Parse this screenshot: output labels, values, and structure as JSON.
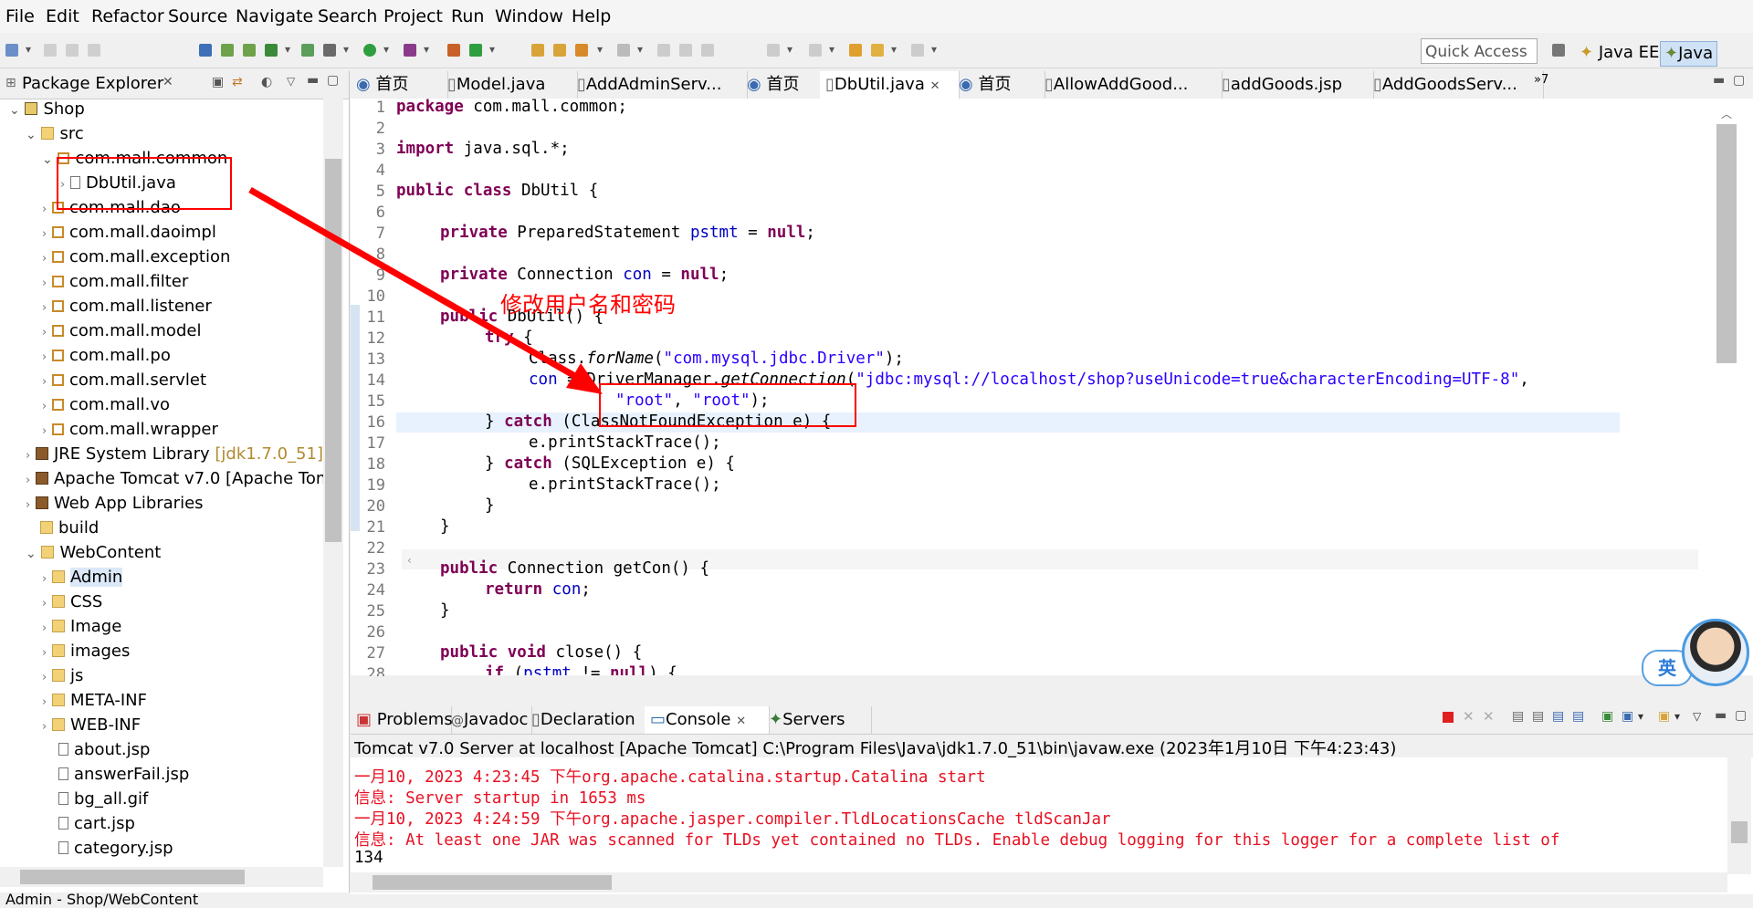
{
  "menu": [
    "File",
    "Edit",
    "Refactor",
    "Source",
    "Navigate",
    "Search",
    "Project",
    "Run",
    "Window",
    "Help"
  ],
  "toolbar": {
    "quick_access_placeholder": "Quick Access",
    "perspectives": [
      "Java EE",
      "Java"
    ]
  },
  "package_explorer": {
    "title": "Package Explorer",
    "items": [
      {
        "label": "Shop",
        "icon": "project-icon"
      },
      {
        "label": "src",
        "icon": "source-folder-icon"
      },
      {
        "label": "com.mall.common",
        "icon": "package-icon"
      },
      {
        "label": "DbUtil.java",
        "icon": "java-file-icon"
      },
      {
        "label": "com.mall.dao",
        "icon": "package-icon"
      },
      {
        "label": "com.mall.daoimpl",
        "icon": "package-icon"
      },
      {
        "label": "com.mall.exception",
        "icon": "package-icon"
      },
      {
        "label": "com.mall.filter",
        "icon": "package-icon"
      },
      {
        "label": "com.mall.listener",
        "icon": "package-icon"
      },
      {
        "label": "com.mall.model",
        "icon": "package-icon"
      },
      {
        "label": "com.mall.po",
        "icon": "package-icon"
      },
      {
        "label": "com.mall.servlet",
        "icon": "package-icon"
      },
      {
        "label": "com.mall.vo",
        "icon": "package-icon"
      },
      {
        "label": "com.mall.wrapper",
        "icon": "package-icon"
      },
      {
        "label": "JRE System Library",
        "suffix": "[jdk1.7.0_51]",
        "icon": "library-icon"
      },
      {
        "label": "Apache Tomcat v7.0 [Apache Tom",
        "icon": "library-icon"
      },
      {
        "label": "Web App Libraries",
        "icon": "library-icon"
      },
      {
        "label": "build",
        "icon": "folder-icon"
      },
      {
        "label": "WebContent",
        "icon": "folder-icon"
      },
      {
        "label": "Admin",
        "icon": "folder-icon"
      },
      {
        "label": "CSS",
        "icon": "folder-icon"
      },
      {
        "label": "Image",
        "icon": "folder-icon"
      },
      {
        "label": "images",
        "icon": "folder-icon"
      },
      {
        "label": "js",
        "icon": "folder-icon"
      },
      {
        "label": "META-INF",
        "icon": "folder-icon"
      },
      {
        "label": "WEB-INF",
        "icon": "folder-icon"
      },
      {
        "label": "about.jsp",
        "icon": "file-icon"
      },
      {
        "label": "answerFail.jsp",
        "icon": "file-icon"
      },
      {
        "label": "bg_all.gif",
        "icon": "file-icon"
      },
      {
        "label": "cart.jsp",
        "icon": "file-icon"
      },
      {
        "label": "category.jsp",
        "icon": "file-icon"
      }
    ]
  },
  "editor_tabs": [
    "首页",
    "Model.java",
    "AddAdminServ...",
    "首页",
    "DbUtil.java",
    "首页",
    "AllowAddGood...",
    "addGoods.jsp",
    "AddGoodsServ..."
  ],
  "editor_tab_overflow": "»7",
  "annotation": {
    "text": "修改用户名和密码",
    "color": "#ff0000"
  },
  "code": {
    "line_numbers": [
      "1",
      "2",
      "3",
      "4",
      "5",
      "6",
      "7",
      "8",
      "9",
      "10",
      "11",
      "12",
      "13",
      "14",
      "15",
      "16",
      "17",
      "18",
      "19",
      "20",
      "21",
      "22",
      "23",
      "24",
      "25",
      "26",
      "27",
      "28"
    ],
    "l1_kw": "package",
    "l1_rest": " com.mall.common;",
    "l3_kw": "import",
    "l3_rest": " java.sql.*;",
    "l5_kw": "public class",
    "l5_rest": " DbUtil {",
    "l7_kw": "private",
    "l7_type": " PreparedStatement ",
    "l7_fld": "pstmt",
    "l7_eq": " = ",
    "l7_null": "null",
    "l7_end": ";",
    "l9_kw": "private",
    "l9_type": " Connection ",
    "l9_fld": "con",
    "l9_eq": " = ",
    "l9_null": "null",
    "l9_end": ";",
    "l11_kw": "public",
    "l11_rest": " DbUtil() {",
    "l12_kw": "try",
    "l12_rest": " {",
    "l13_a": "Class.",
    "l13_m": "forName",
    "l13_b": "(",
    "l13_s": "\"com.mysql.jdbc.Driver\"",
    "l13_c": ");",
    "l14_fld": "con",
    "l14_a": " = DriverManager.",
    "l14_m": "getConnection",
    "l14_b": "(",
    "l14_s": "\"jdbc:mysql://localhost/shop?useUnicode=true&characterEncoding=UTF-8\"",
    "l14_c": ",",
    "l15_s1": "\"root\"",
    "l15_a": ", ",
    "l15_s2": "\"root\"",
    "l15_c": ");",
    "l16_a": "} ",
    "l16_kw": "catch",
    "l16_rest": " (ClassNotFoundException e) {",
    "l17": "e.printStackTrace();",
    "l18_a": "} ",
    "l18_kw": "catch",
    "l18_rest": " (SQLException e) {",
    "l19": "e.printStackTrace();",
    "l20": "}",
    "l21": "}",
    "l23_kw": "public",
    "l23_rest": " Connection getCon() {",
    "l24_kw": "return",
    "l24_fld": " con",
    "l24_end": ";",
    "l25": "}",
    "l27_kw": "public void",
    "l27_rest": " close() {",
    "l28_kw": "if",
    "l28_a": " (",
    "l28_fld": "pstmt",
    "l28_b": " != ",
    "l28_null": "null",
    "l28_c": ") {"
  },
  "console_tabs": [
    "Problems",
    "Javadoc",
    "Declaration",
    "Console",
    "Servers"
  ],
  "console": {
    "header": "Tomcat v7.0 Server at localhost [Apache Tomcat] C:\\Program Files\\Java\\jdk1.7.0_51\\bin\\javaw.exe (2023年1月10日 下午4:23:43)",
    "lines": [
      "一月10, 2023 4:23:45 下午org.apache.catalina.startup.Catalina start",
      "信息: Server startup in 1653 ms",
      "一月10, 2023 4:24:59 下午org.apache.jasper.compiler.TldLocationsCache tldScanJar",
      "信息: At least one JAR was scanned for TLDs yet contained no TLDs. Enable debug logging for this logger for a complete list of",
      "134"
    ]
  },
  "ime_label": "英",
  "status": "Admin - Shop/WebContent"
}
